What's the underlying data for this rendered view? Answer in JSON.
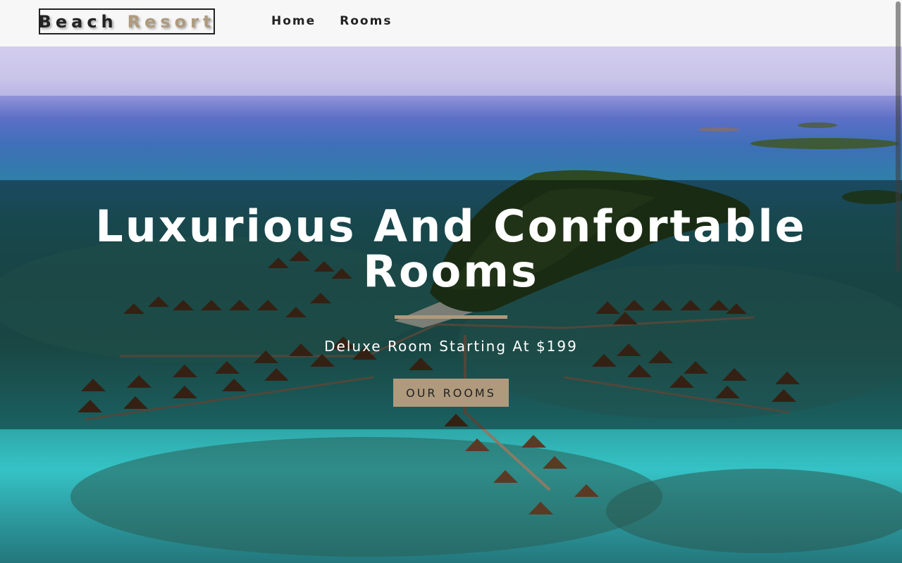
{
  "brand": {
    "part1": "Beach",
    "part2": "Resort"
  },
  "nav": {
    "items": [
      {
        "label": "Home"
      },
      {
        "label": "Rooms"
      }
    ]
  },
  "banner": {
    "title": "Luxurious And Confortable Rooms",
    "subtitle": "Deluxe Room Starting At $199",
    "button_label": "OUR ROOMS"
  },
  "colors": {
    "accent": "#af9a7d",
    "navbar_bg": "#f7f7f7",
    "text_dark": "#222222"
  },
  "icons": [
    "aerial-resort-photo"
  ]
}
